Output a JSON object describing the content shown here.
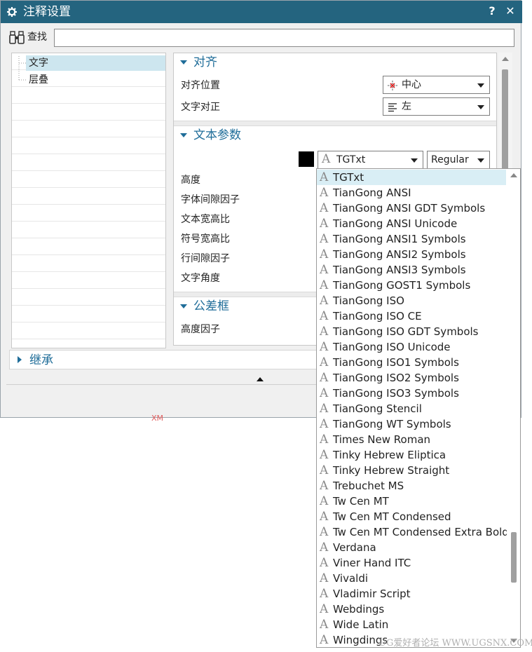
{
  "dialog": {
    "title": "注释设置",
    "help_label": "?",
    "close_label": "✕"
  },
  "find": {
    "label": "查找",
    "value": ""
  },
  "tree": {
    "items": [
      {
        "label": "文字",
        "selected": true
      },
      {
        "label": "层叠",
        "selected": false
      }
    ]
  },
  "sections": {
    "align": {
      "title": "对齐",
      "position_label": "对齐位置",
      "position_value": "中心",
      "justify_label": "文字对正",
      "justify_value": "左"
    },
    "text_params": {
      "title": "文本参数",
      "color": "#000000",
      "font_value": "TGTxt",
      "style_value": "Regular",
      "rows": [
        "高度",
        "字体间隙因子",
        "文本宽高比",
        "符号宽高比",
        "行间隙因子",
        "文字角度"
      ]
    },
    "tolerance": {
      "title": "公差框",
      "height_factor_label": "高度因子"
    },
    "inherit": {
      "title": "继承"
    }
  },
  "font_dropdown": {
    "selected": "TGTxt",
    "items": [
      "TGTxt",
      "TianGong ANSI",
      "TianGong ANSI GDT Symbols",
      "TianGong ANSI Unicode",
      "TianGong ANSI1 Symbols",
      "TianGong ANSI2 Symbols",
      "TianGong ANSI3 Symbols",
      "TianGong GOST1 Symbols",
      "TianGong ISO",
      "TianGong ISO CE",
      "TianGong ISO GDT Symbols",
      "TianGong ISO Unicode",
      "TianGong ISO1 Symbols",
      "TianGong ISO2 Symbols",
      "TianGong ISO3 Symbols",
      "TianGong Stencil",
      "TianGong WT Symbols",
      "Times New Roman",
      "Tinky Hebrew Eliptica",
      "Tinky Hebrew Straight",
      "Trebuchet MS",
      "Tw Cen MT",
      "Tw Cen MT Condensed",
      "Tw Cen MT Condensed Extra Bold",
      "Verdana",
      "Viner Hand ITC",
      "Vivaldi",
      "Vladimir Script",
      "Webdings",
      "Wide Latin",
      "Wingdings"
    ]
  },
  "watermark": "UG爱好者论坛 WWW.UGSNX.COM",
  "stray_text": "XM",
  "colors": {
    "titlebar": "#24647f",
    "section_title": "#1f6d99",
    "selection": "#cde6ef"
  }
}
